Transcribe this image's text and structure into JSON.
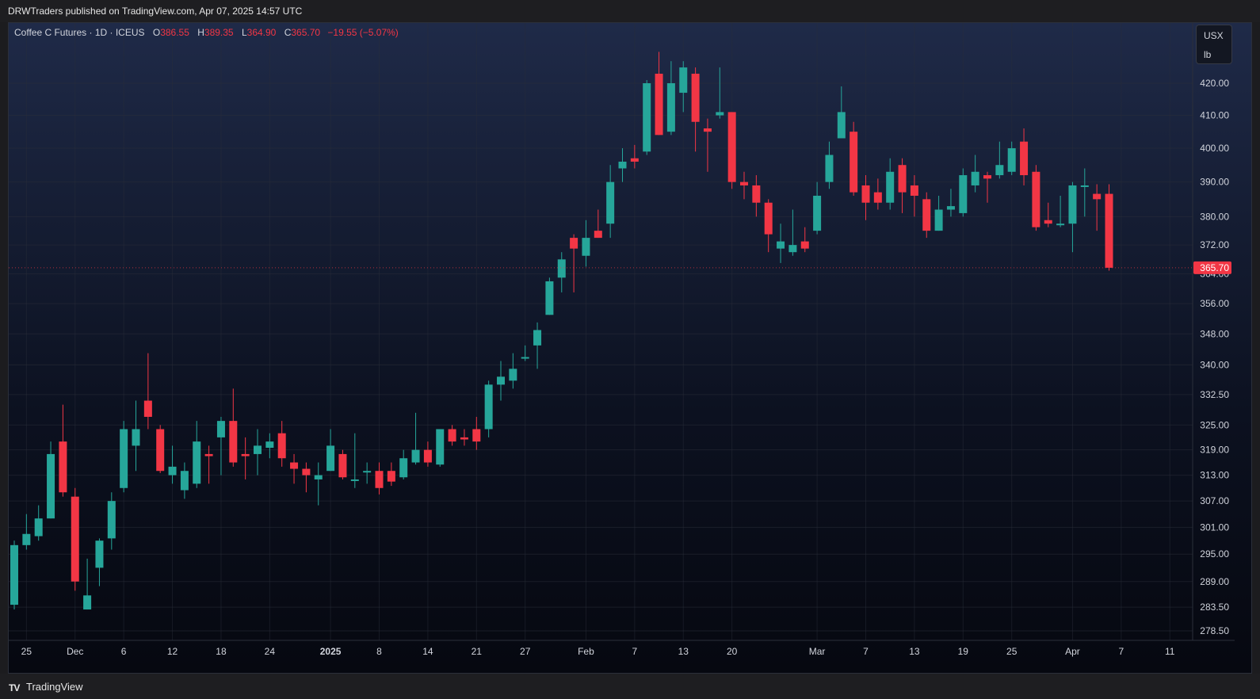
{
  "header": {
    "text": "DRWTraders published on TradingView.com, Apr 07, 2025 14:57 UTC"
  },
  "legend": {
    "symbol": "Coffee C Futures · 1D · ICEUS",
    "o_label": "O",
    "o_value": "386.55",
    "h_label": "H",
    "h_value": "389.35",
    "l_label": "L",
    "l_value": "364.90",
    "c_label": "C",
    "c_value": "365.70",
    "change": "−19.55 (−5.07%)"
  },
  "unit_selector": {
    "currency": "USX",
    "unit": "lb"
  },
  "footer": {
    "brand": "TradingView",
    "logo_glyph": "TV"
  },
  "colors": {
    "up": "#26a69a",
    "down": "#f23645",
    "axis_text": "#d1d4dc",
    "grid": "#2a2e39"
  },
  "chart_data": {
    "type": "candlestick",
    "symbol": "Coffee C Futures",
    "interval": "1D",
    "exchange": "ICEUS",
    "last_price_label": "365.70",
    "y_tick_labels": [
      "278.50",
      "283.50",
      "289.00",
      "295.00",
      "301.00",
      "307.00",
      "313.00",
      "319.00",
      "325.00",
      "332.50",
      "340.00",
      "348.00",
      "356.00",
      "364.00",
      "372.00",
      "380.00",
      "390.00",
      "400.00",
      "410.00",
      "420.00"
    ],
    "x_tick_labels": [
      "25",
      "Dec",
      "6",
      "12",
      "18",
      "24",
      "2025",
      "8",
      "14",
      "21",
      "27",
      "Feb",
      "7",
      "13",
      "20",
      "Mar",
      "7",
      "13",
      "19",
      "25",
      "Apr",
      "7",
      "11"
    ],
    "scale": "log",
    "candles": [
      {
        "o": 284.0,
        "h": 298.0,
        "l": 283.0,
        "c": 297.0
      },
      {
        "o": 297.0,
        "h": 304.0,
        "l": 296.0,
        "c": 299.5
      },
      {
        "o": 299.0,
        "h": 306.0,
        "l": 298.0,
        "c": 303.0
      },
      {
        "o": 303.0,
        "h": 321.0,
        "l": 303.0,
        "c": 318.0
      },
      {
        "o": 321.0,
        "h": 330.0,
        "l": 308.0,
        "c": 309.0
      },
      {
        "o": 308.0,
        "h": 310.0,
        "l": 287.0,
        "c": 289.0
      },
      {
        "o": 283.0,
        "h": 294.0,
        "l": 283.0,
        "c": 286.0
      },
      {
        "o": 292.0,
        "h": 298.5,
        "l": 288.0,
        "c": 298.0
      },
      {
        "o": 298.5,
        "h": 309.0,
        "l": 296.0,
        "c": 307.0
      },
      {
        "o": 310.0,
        "h": 326.0,
        "l": 309.0,
        "c": 324.0
      },
      {
        "o": 320.0,
        "h": 331.0,
        "l": 314.0,
        "c": 324.0
      },
      {
        "o": 331.0,
        "h": 343.0,
        "l": 324.0,
        "c": 327.0
      },
      {
        "o": 324.0,
        "h": 325.0,
        "l": 313.5,
        "c": 314.0
      },
      {
        "o": 313.0,
        "h": 320.0,
        "l": 311.0,
        "c": 315.0
      },
      {
        "o": 309.5,
        "h": 316.0,
        "l": 307.5,
        "c": 314.0
      },
      {
        "o": 311.0,
        "h": 326.0,
        "l": 310.0,
        "c": 321.0
      },
      {
        "o": 318.0,
        "h": 320.0,
        "l": 311.0,
        "c": 317.5
      },
      {
        "o": 322.0,
        "h": 327.0,
        "l": 313.0,
        "c": 326.0
      },
      {
        "o": 326.0,
        "h": 334.0,
        "l": 315.0,
        "c": 316.0
      },
      {
        "o": 318.0,
        "h": 322.0,
        "l": 312.0,
        "c": 317.5
      },
      {
        "o": 318.0,
        "h": 324.0,
        "l": 313.0,
        "c": 320.0
      },
      {
        "o": 319.5,
        "h": 323.0,
        "l": 317.0,
        "c": 321.0
      },
      {
        "o": 323.0,
        "h": 326.0,
        "l": 315.0,
        "c": 317.0
      },
      {
        "o": 316.0,
        "h": 318.0,
        "l": 311.0,
        "c": 314.5
      },
      {
        "o": 314.5,
        "h": 316.0,
        "l": 309.0,
        "c": 313.0
      },
      {
        "o": 312.0,
        "h": 316.0,
        "l": 306.0,
        "c": 313.0
      },
      {
        "o": 314.0,
        "h": 324.0,
        "l": 314.0,
        "c": 320.0
      },
      {
        "o": 318.0,
        "h": 319.0,
        "l": 312.0,
        "c": 312.5
      },
      {
        "o": 312.0,
        "h": 323.0,
        "l": 310.0,
        "c": 312.0
      },
      {
        "o": 314.0,
        "h": 316.0,
        "l": 311.0,
        "c": 314.0
      },
      {
        "o": 314.0,
        "h": 316.0,
        "l": 308.5,
        "c": 310.0
      },
      {
        "o": 314.0,
        "h": 316.0,
        "l": 310.5,
        "c": 311.5
      },
      {
        "o": 312.5,
        "h": 319.0,
        "l": 312.0,
        "c": 317.0
      },
      {
        "o": 316.0,
        "h": 328.0,
        "l": 315.5,
        "c": 319.0
      },
      {
        "o": 319.0,
        "h": 321.0,
        "l": 315.0,
        "c": 316.0
      },
      {
        "o": 315.5,
        "h": 324.0,
        "l": 315.0,
        "c": 324.0
      },
      {
        "o": 324.0,
        "h": 325.0,
        "l": 320.0,
        "c": 321.0
      },
      {
        "o": 322.0,
        "h": 324.0,
        "l": 320.0,
        "c": 321.5
      },
      {
        "o": 324.0,
        "h": 327.0,
        "l": 319.0,
        "c": 321.0
      },
      {
        "o": 324.0,
        "h": 336.0,
        "l": 322.0,
        "c": 335.0
      },
      {
        "o": 335.0,
        "h": 341.0,
        "l": 331.0,
        "c": 337.0
      },
      {
        "o": 336.0,
        "h": 343.0,
        "l": 334.0,
        "c": 339.0
      },
      {
        "o": 342.0,
        "h": 345.0,
        "l": 341.0,
        "c": 342.0
      },
      {
        "o": 345.0,
        "h": 351.0,
        "l": 339.0,
        "c": 349.0
      },
      {
        "o": 353.0,
        "h": 363.0,
        "l": 353.0,
        "c": 362.0
      },
      {
        "o": 363.0,
        "h": 370.0,
        "l": 359.0,
        "c": 368.0
      },
      {
        "o": 374.0,
        "h": 375.0,
        "l": 359.0,
        "c": 371.0
      },
      {
        "o": 369.0,
        "h": 379.0,
        "l": 366.0,
        "c": 374.0
      },
      {
        "o": 376.0,
        "h": 382.0,
        "l": 374.0,
        "c": 374.0
      },
      {
        "o": 378.0,
        "h": 395.0,
        "l": 374.0,
        "c": 390.0
      },
      {
        "o": 394.0,
        "h": 400.0,
        "l": 390.0,
        "c": 396.0
      },
      {
        "o": 397.0,
        "h": 401.0,
        "l": 394.0,
        "c": 396.0
      },
      {
        "o": 399.0,
        "h": 421.0,
        "l": 398.0,
        "c": 420.0
      },
      {
        "o": 423.0,
        "h": 430.0,
        "l": 404.0,
        "c": 404.0
      },
      {
        "o": 405.0,
        "h": 427.0,
        "l": 404.0,
        "c": 420.0
      },
      {
        "o": 417.0,
        "h": 427.0,
        "l": 411.0,
        "c": 425.0
      },
      {
        "o": 423.0,
        "h": 425.0,
        "l": 399.0,
        "c": 408.0
      },
      {
        "o": 406.0,
        "h": 409.0,
        "l": 393.0,
        "c": 405.0
      },
      {
        "o": 410.0,
        "h": 425.0,
        "l": 409.0,
        "c": 411.0
      },
      {
        "o": 411.0,
        "h": 411.0,
        "l": 388.0,
        "c": 390.0
      },
      {
        "o": 390.0,
        "h": 393.0,
        "l": 385.0,
        "c": 389.0
      },
      {
        "o": 389.0,
        "h": 392.0,
        "l": 380.0,
        "c": 384.0
      },
      {
        "o": 384.0,
        "h": 385.0,
        "l": 370.0,
        "c": 375.0
      },
      {
        "o": 371.0,
        "h": 378.0,
        "l": 367.0,
        "c": 373.0
      },
      {
        "o": 370.0,
        "h": 382.0,
        "l": 369.0,
        "c": 372.0
      },
      {
        "o": 373.0,
        "h": 377.0,
        "l": 370.0,
        "c": 371.0
      },
      {
        "o": 376.0,
        "h": 390.0,
        "l": 375.0,
        "c": 386.0
      },
      {
        "o": 390.0,
        "h": 402.0,
        "l": 388.0,
        "c": 398.0
      },
      {
        "o": 403.0,
        "h": 419.0,
        "l": 403.0,
        "c": 411.0
      },
      {
        "o": 405.0,
        "h": 408.0,
        "l": 386.0,
        "c": 387.0
      },
      {
        "o": 389.0,
        "h": 392.0,
        "l": 379.0,
        "c": 384.0
      },
      {
        "o": 387.0,
        "h": 391.0,
        "l": 382.0,
        "c": 384.0
      },
      {
        "o": 384.0,
        "h": 397.0,
        "l": 382.0,
        "c": 393.0
      },
      {
        "o": 395.0,
        "h": 397.0,
        "l": 381.0,
        "c": 387.0
      },
      {
        "o": 389.0,
        "h": 392.0,
        "l": 380.0,
        "c": 386.0
      },
      {
        "o": 385.0,
        "h": 387.0,
        "l": 374.0,
        "c": 376.0
      },
      {
        "o": 376.0,
        "h": 386.0,
        "l": 376.0,
        "c": 382.0
      },
      {
        "o": 382.0,
        "h": 388.0,
        "l": 380.0,
        "c": 383.0
      },
      {
        "o": 381.0,
        "h": 394.0,
        "l": 380.0,
        "c": 392.0
      },
      {
        "o": 389.0,
        "h": 398.0,
        "l": 387.0,
        "c": 393.0
      },
      {
        "o": 392.0,
        "h": 393.0,
        "l": 384.0,
        "c": 391.0
      },
      {
        "o": 392.0,
        "h": 402.0,
        "l": 391.0,
        "c": 395.0
      },
      {
        "o": 393.0,
        "h": 402.0,
        "l": 392.0,
        "c": 400.0
      },
      {
        "o": 402.0,
        "h": 406.0,
        "l": 389.0,
        "c": 392.0
      },
      {
        "o": 393.0,
        "h": 395.0,
        "l": 376.0,
        "c": 377.0
      },
      {
        "o": 379.0,
        "h": 384.0,
        "l": 377.0,
        "c": 378.0
      },
      {
        "o": 378.0,
        "h": 386.0,
        "l": 377.0,
        "c": 378.0
      },
      {
        "o": 378.0,
        "h": 390.0,
        "l": 370.0,
        "c": 389.0
      },
      {
        "o": 389.0,
        "h": 394.0,
        "l": 380.0,
        "c": 389.0
      },
      {
        "o": 386.55,
        "h": 389.35,
        "l": 376.0,
        "c": 385.0
      },
      {
        "o": 386.55,
        "h": 389.35,
        "l": 364.9,
        "c": 365.7
      }
    ]
  }
}
